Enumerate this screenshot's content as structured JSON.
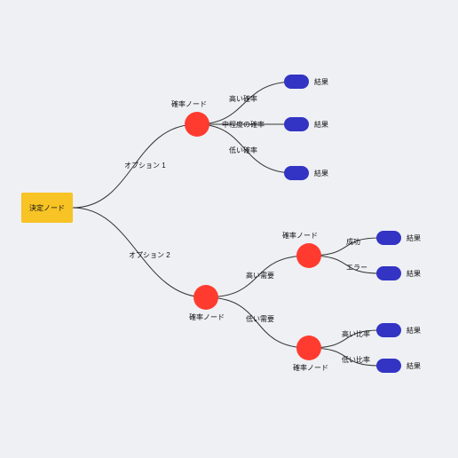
{
  "diagram": {
    "decision_label": "決定ノード",
    "chance_label": "確率ノード",
    "outcome_label": "結果",
    "edges": {
      "opt1": "オプション 1",
      "opt2": "オプション 2",
      "high_prob": "高い確率",
      "mid_prob": "中程度の確率",
      "low_prob": "低い確率",
      "high_demand": "高い需要",
      "low_demand": "低い需要",
      "success": "成功",
      "error": "エラー",
      "high_ratio": "高い比率",
      "low_ratio": "低い比率"
    }
  },
  "colors": {
    "decision": "#f7c325",
    "chance": "#ff3b2f",
    "outcome": "#3333c4",
    "bg": "#eef0f3"
  }
}
